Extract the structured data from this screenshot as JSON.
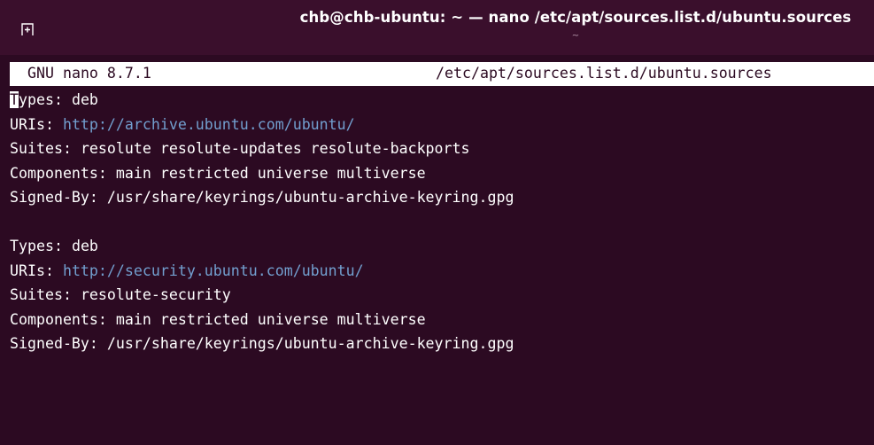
{
  "window": {
    "title": "chb@chb-ubuntu: ~ — nano /etc/apt/sources.list.d/ubuntu.sources",
    "subtitle": "~",
    "new_tab_icon": "new-tab-icon"
  },
  "nano": {
    "version": "GNU nano 8.7.1",
    "filename": "/etc/apt/sources.list.d/ubuntu.sources"
  },
  "file": {
    "block1": {
      "types_key_first": "T",
      "types_key_rest": "ypes:",
      "types_val": "deb",
      "uris_key": "URIs:",
      "uris_val": "http://archive.ubuntu.com/ubuntu/",
      "suites_key": "Suites:",
      "suites_val": "resolute resolute-updates resolute-backports",
      "components_key": "Components:",
      "components_val": "main restricted universe multiverse",
      "signed_key": "Signed-By:",
      "signed_val": "/usr/share/keyrings/ubuntu-archive-keyring.gpg"
    },
    "block2": {
      "types_key": "Types:",
      "types_val": "deb",
      "uris_key": "URIs:",
      "uris_val": "http://security.ubuntu.com/ubuntu/",
      "suites_key": "Suites:",
      "suites_val": "resolute-security",
      "components_key": "Components:",
      "components_val": "main restricted universe multiverse",
      "signed_key": "Signed-By:",
      "signed_val": "/usr/share/keyrings/ubuntu-archive-keyring.gpg"
    }
  },
  "colors": {
    "terminal_bg": "#2c0a22",
    "titlebar_bg": "#3a0f2c",
    "url": "#729fcf"
  }
}
